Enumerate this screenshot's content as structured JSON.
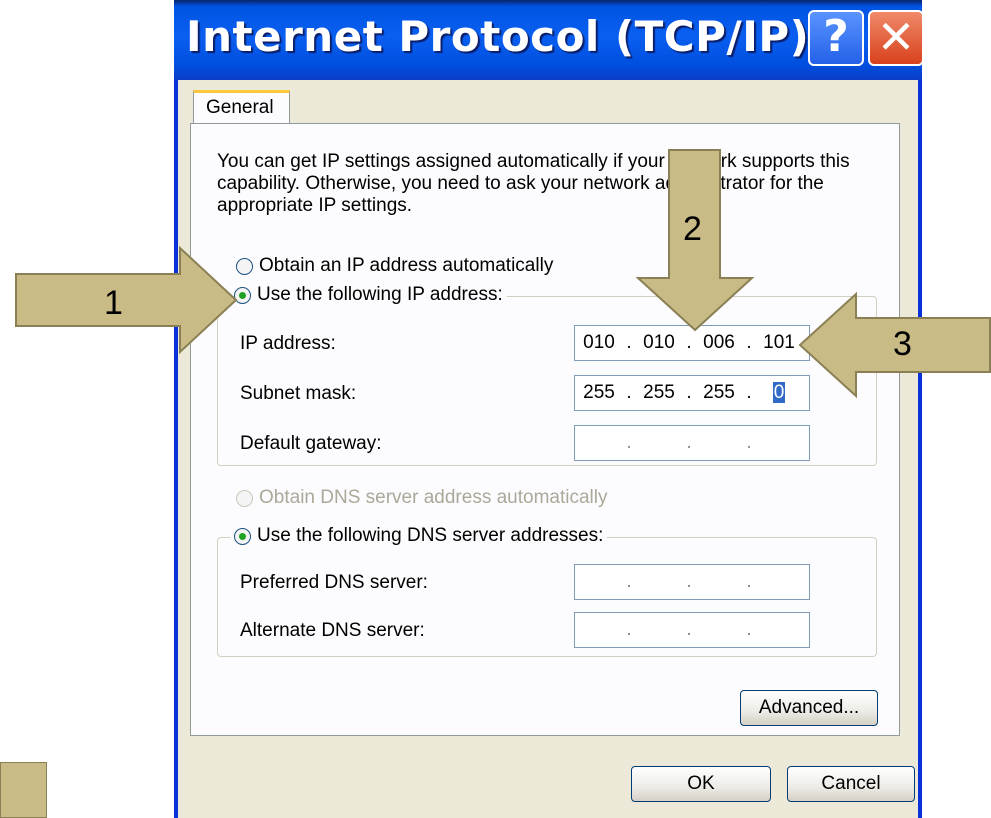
{
  "dialog": {
    "title": "Internet Protocol (TCP/IP) P...",
    "help_glyph": "?",
    "close_glyph": "✕",
    "tab_label": "General",
    "description": "You can get IP settings assigned automatically if your network supports this capability. Otherwise, you need to ask your network administrator for the appropriate IP settings.",
    "ip_section": {
      "auto_label": "Obtain an IP address automatically",
      "manual_label": "Use the following IP address:",
      "selected": "manual",
      "fields": [
        {
          "label": "IP address:",
          "octets": [
            "010",
            "010",
            "006",
            "101"
          ]
        },
        {
          "label": "Subnet mask:",
          "octets": [
            "255",
            "255",
            "255",
            "0"
          ]
        },
        {
          "label": "Default gateway:",
          "octets": [
            "",
            "",
            "",
            ""
          ]
        }
      ]
    },
    "dns_section": {
      "auto_label": "Obtain DNS server address automatically",
      "manual_label": "Use the following DNS server addresses:",
      "selected": "manual",
      "fields": [
        {
          "label": "Preferred DNS server:",
          "octets": [
            "",
            "",
            "",
            ""
          ]
        },
        {
          "label": "Alternate DNS server:",
          "octets": [
            "",
            "",
            "",
            ""
          ]
        }
      ]
    },
    "advanced_label": "Advanced...",
    "ok_label": "OK",
    "cancel_label": "Cancel"
  },
  "annotations": [
    {
      "number": "1"
    },
    {
      "number": "2"
    },
    {
      "number": "3"
    }
  ],
  "colors": {
    "arrow_fill": "#c8bb86",
    "arrow_stroke": "#8a7f55",
    "titlebar": "#0054e3",
    "dialog_bg": "#ece9d8"
  }
}
